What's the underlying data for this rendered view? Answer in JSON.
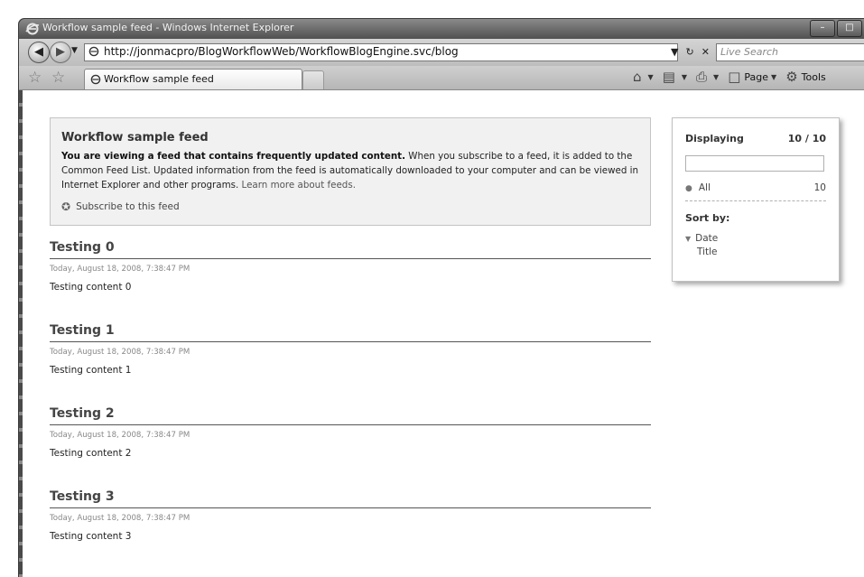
{
  "window": {
    "title": "Workflow sample feed - Windows Internet Explorer",
    "controls": {
      "minimize": "–",
      "maximize": "□"
    }
  },
  "address_bar": {
    "url": "http://jonmacpro/BlogWorkflowWeb/WorkflowBlogEngine.svc/blog",
    "search_placeholder": "Live Search"
  },
  "tabs": [
    {
      "label": "Workflow sample feed"
    }
  ],
  "command_bar": {
    "page_label": "Page",
    "tools_label": "Tools"
  },
  "feed_info": {
    "title": "Workflow sample feed",
    "intro_bold": "You are viewing a feed that contains frequently updated content.",
    "intro_text": " When you subscribe to a feed, it is added to the Common Feed List. Updated information from the feed is automatically downloaded to your computer and can be viewed in Internet Explorer and other programs. ",
    "learn_more": "Learn more about feeds.",
    "subscribe_label": "Subscribe to this feed"
  },
  "entries": [
    {
      "title": "Testing 0",
      "date": "Today, August 18, 2008, 7:38:47 PM",
      "body": "Testing content 0"
    },
    {
      "title": "Testing 1",
      "date": "Today, August 18, 2008, 7:38:47 PM",
      "body": "Testing content 1"
    },
    {
      "title": "Testing 2",
      "date": "Today, August 18, 2008, 7:38:47 PM",
      "body": "Testing content 2"
    },
    {
      "title": "Testing 3",
      "date": "Today, August 18, 2008, 7:38:47 PM",
      "body": "Testing content 3"
    }
  ],
  "sidebar": {
    "displaying_label": "Displaying",
    "displaying_count": "10 / 10",
    "all_label": "All",
    "all_count": "10",
    "sort_label": "Sort by:",
    "sort_options": [
      "Date",
      "Title"
    ]
  }
}
